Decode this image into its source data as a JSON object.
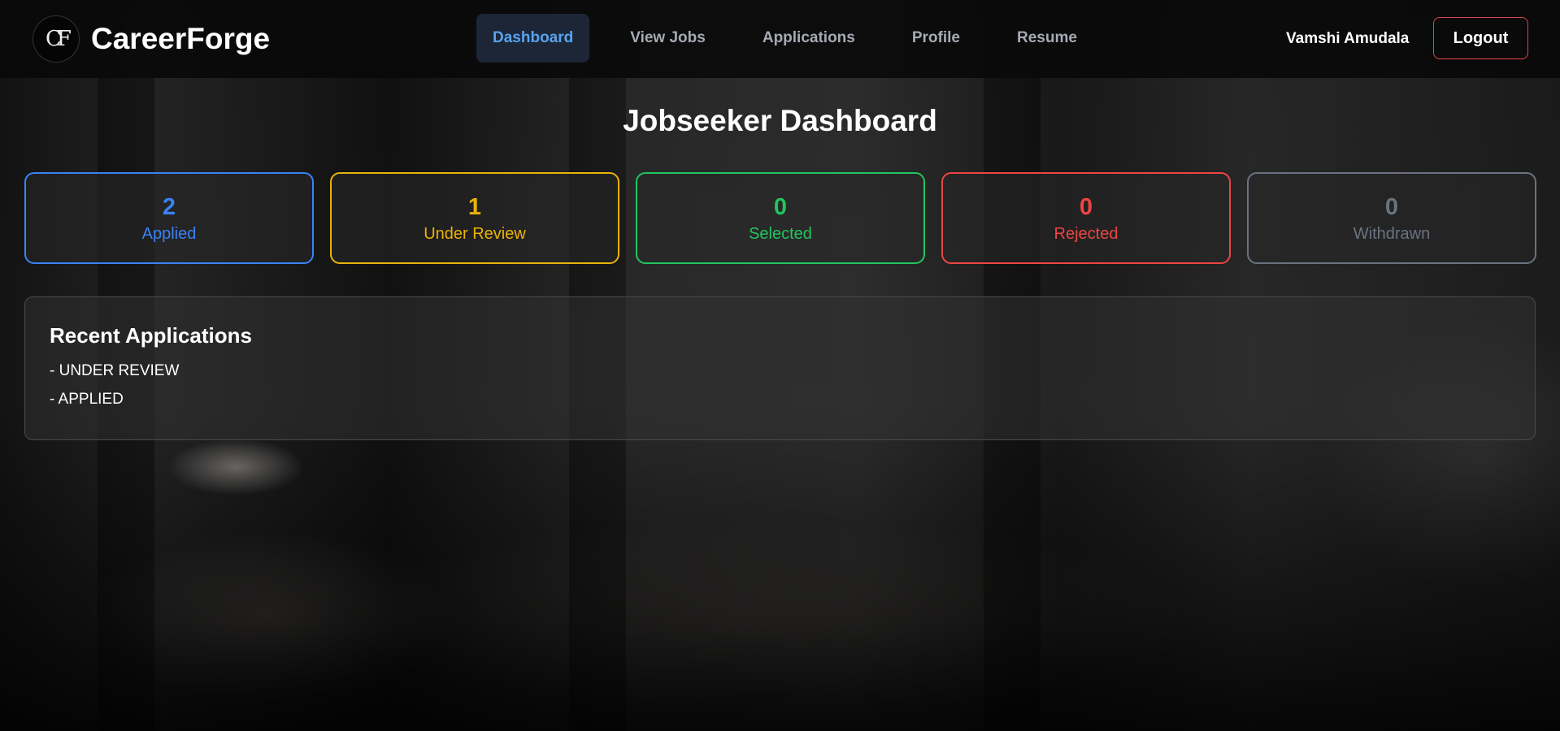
{
  "brand": {
    "logo_text": "CF",
    "name": "CareerForge"
  },
  "nav": [
    {
      "label": "Dashboard",
      "active": true
    },
    {
      "label": "View Jobs",
      "active": false
    },
    {
      "label": "Applications",
      "active": false
    },
    {
      "label": "Profile",
      "active": false
    },
    {
      "label": "Resume",
      "active": false
    }
  ],
  "user": {
    "name": "Vamshi Amudala",
    "logout_label": "Logout"
  },
  "page": {
    "title": "Jobseeker Dashboard"
  },
  "stats": [
    {
      "value": "2",
      "label": "Applied",
      "color": "#3b82f6"
    },
    {
      "value": "1",
      "label": "Under Review",
      "color": "#eab308"
    },
    {
      "value": "0",
      "label": "Selected",
      "color": "#22c55e"
    },
    {
      "value": "0",
      "label": "Rejected",
      "color": "#ef4444"
    },
    {
      "value": "0",
      "label": "Withdrawn",
      "color": "#6b7280"
    }
  ],
  "recent": {
    "title": "Recent Applications",
    "items": [
      "- UNDER REVIEW",
      "- APPLIED"
    ]
  }
}
